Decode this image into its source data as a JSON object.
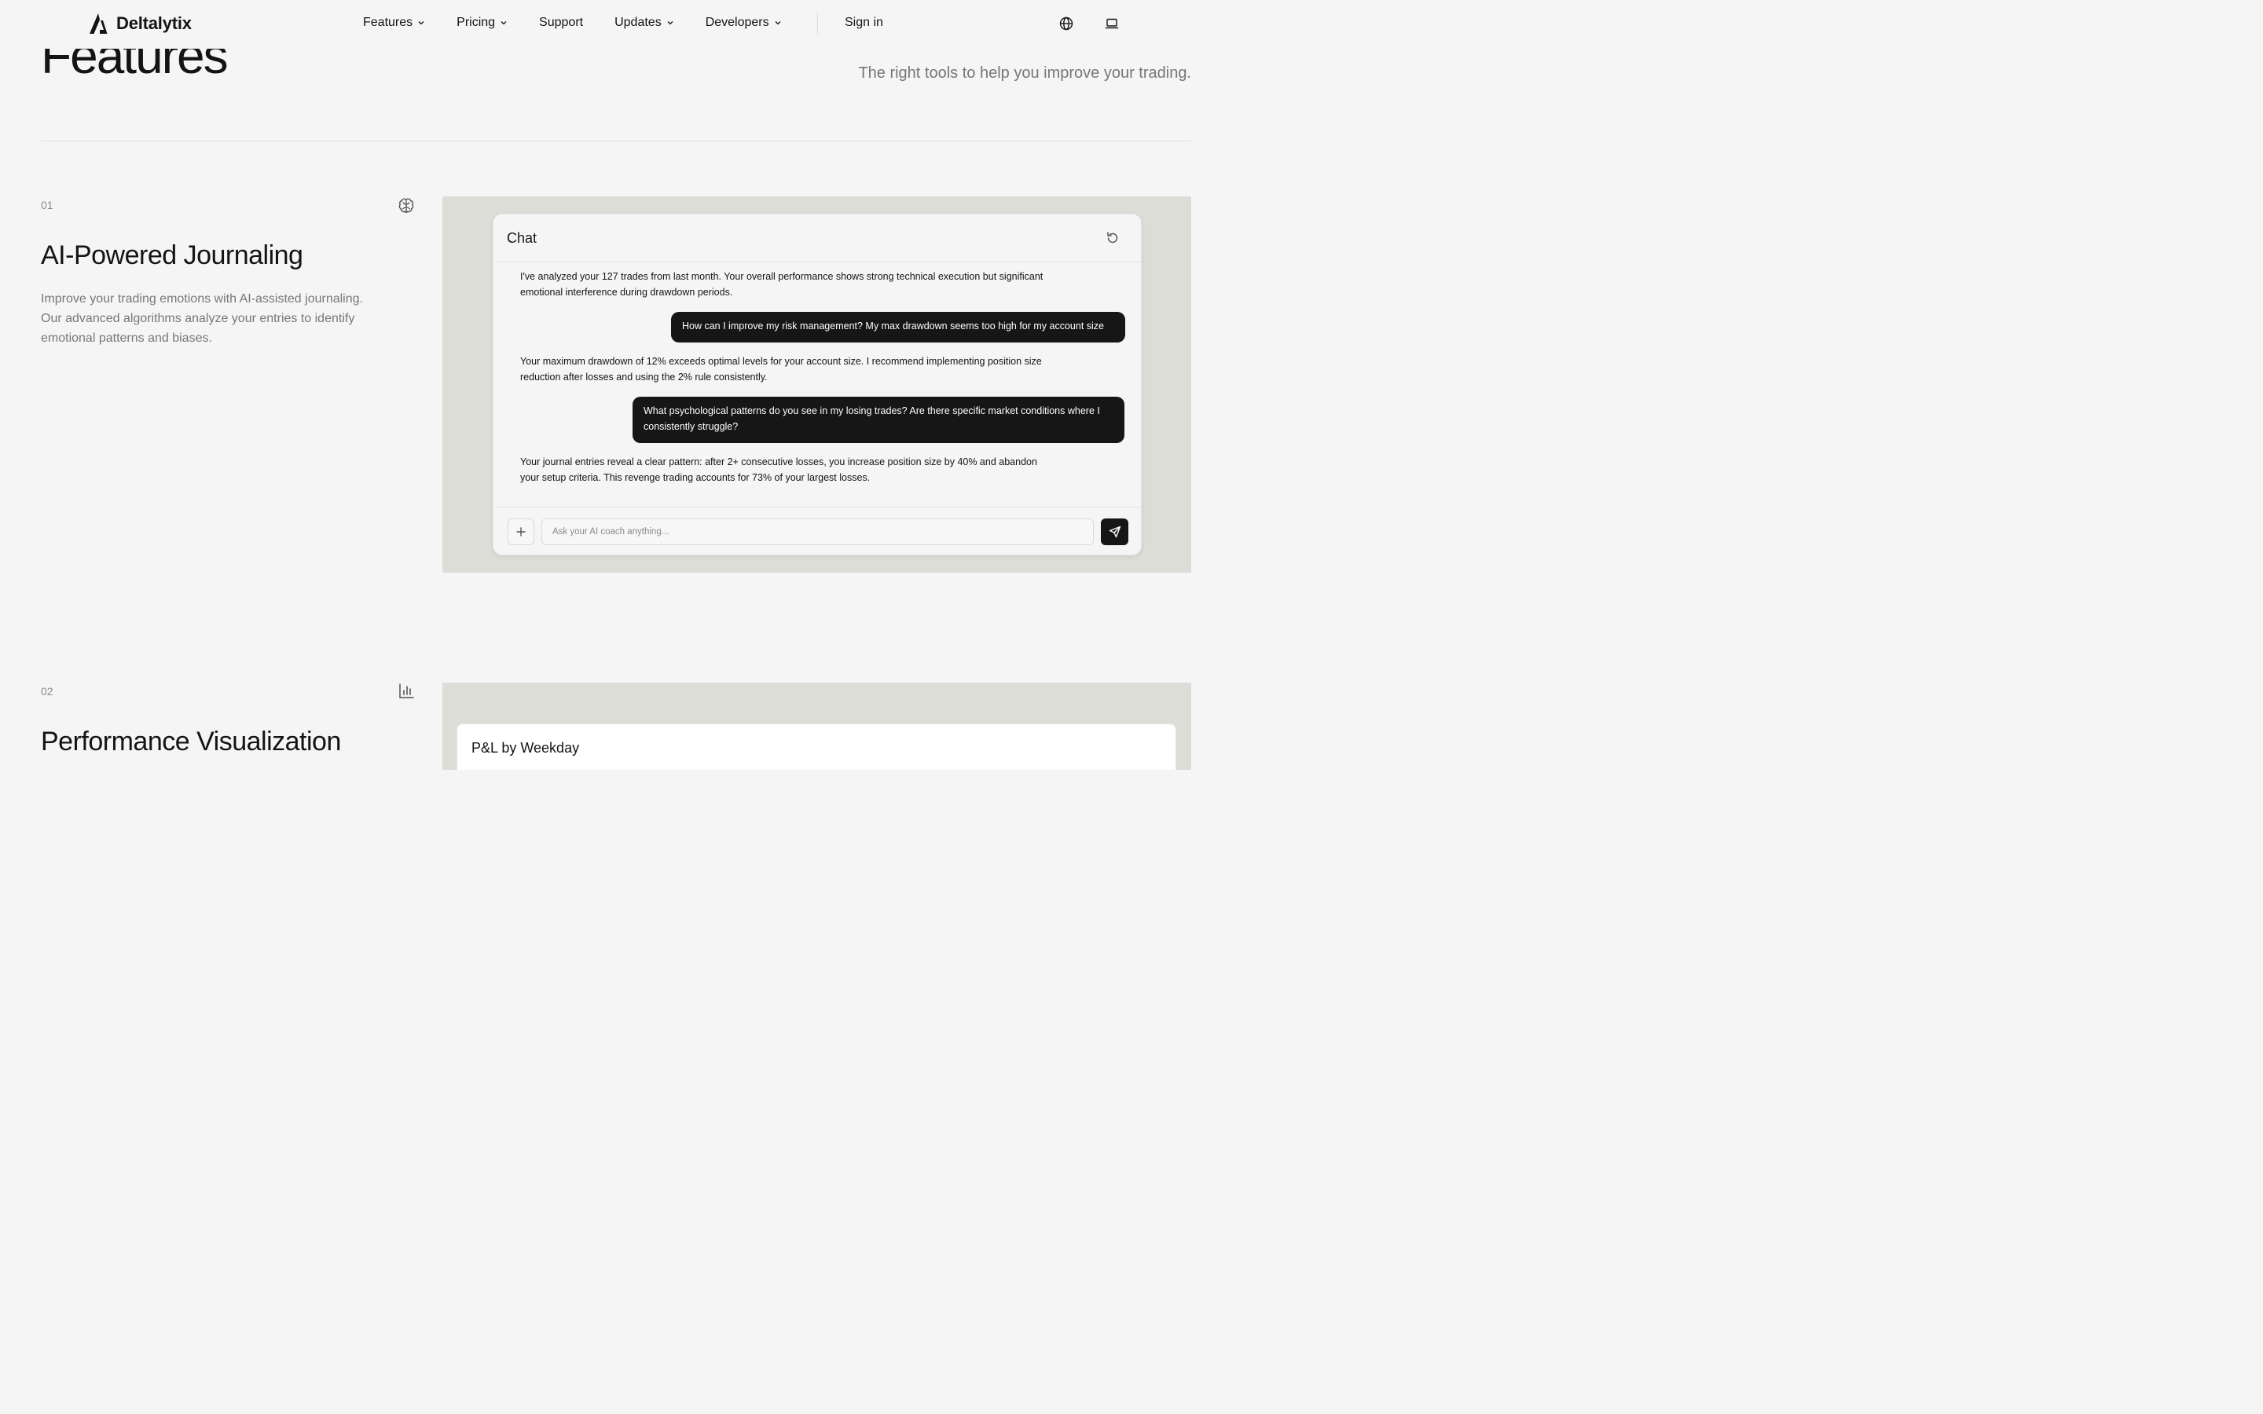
{
  "brand": {
    "name": "Deltalytix"
  },
  "nav": {
    "items": [
      {
        "label": "Features",
        "dropdown": true
      },
      {
        "label": "Pricing",
        "dropdown": true
      },
      {
        "label": "Support",
        "dropdown": false
      },
      {
        "label": "Updates",
        "dropdown": true
      },
      {
        "label": "Developers",
        "dropdown": true
      }
    ],
    "sign_in": "Sign in",
    "icons": [
      "globe-icon",
      "laptop-icon"
    ]
  },
  "hero": {
    "title": "Features",
    "subtitle": "The right tools to help you improve your trading."
  },
  "features": [
    {
      "number": "01",
      "icon": "brain-icon",
      "title": "AI-Powered Journaling",
      "description": "Improve your trading emotions with AI-assisted journaling. Our advanced algorithms analyze your entries to identify emotional patterns and biases."
    },
    {
      "number": "02",
      "icon": "bar-chart-icon",
      "title": "Performance Visualization"
    }
  ],
  "chat": {
    "title": "Chat",
    "messages": [
      {
        "role": "assistant",
        "text": "I've analyzed your 127 trades from last month. Your overall performance shows strong technical execution but significant emotional interference during drawdown periods."
      },
      {
        "role": "user",
        "text": "How can I improve my risk management? My max drawdown seems too high for my account size"
      },
      {
        "role": "assistant",
        "text": "Your maximum drawdown of 12% exceeds optimal levels for your account size. I recommend implementing position size reduction after losses and using the 2% rule consistently."
      },
      {
        "role": "user",
        "text": "What psychological patterns do you see in my losing trades? Are there specific market conditions where I consistently struggle?"
      },
      {
        "role": "assistant",
        "text": "Your journal entries reveal a clear pattern: after 2+ consecutive losses, you increase position size by 40% and abandon your setup criteria. This revenge trading accounts for 73% of your largest losses."
      }
    ],
    "input": {
      "value": "",
      "placeholder": "Ask your AI coach anything..."
    }
  },
  "pnl_card": {
    "title": "P&L by Weekday"
  },
  "colors": {
    "background": "#f5f5f5",
    "panel": "#dcddd7",
    "user_bubble": "#161616",
    "text": "#141414",
    "muted": "#777777"
  }
}
